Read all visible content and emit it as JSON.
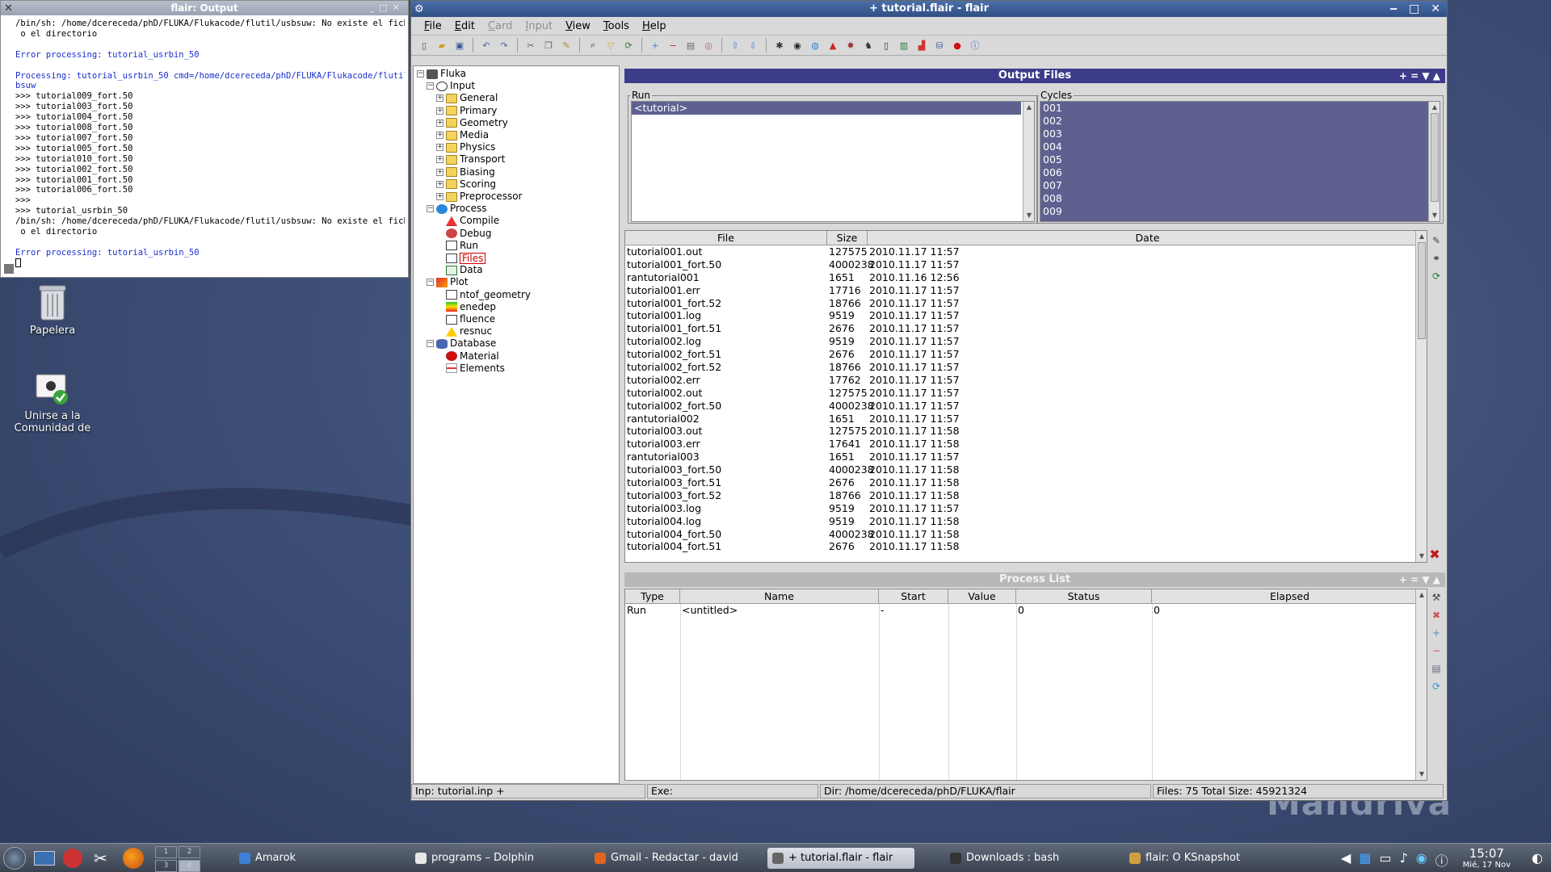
{
  "terminal": {
    "title": "flair: Output",
    "lines": [
      {
        "text": "/bin/sh: /home/dcereceda/phD/FLUKA/Flukacode/flutil/usbsuw: No existe el fichero",
        "color": "black"
      },
      {
        "text": " o el directorio",
        "color": "black"
      },
      {
        "text": "",
        "color": "black"
      },
      {
        "text": "Error processing: tutorial_usrbin_50",
        "color": "blue"
      },
      {
        "text": "",
        "color": "black"
      },
      {
        "text": "Processing: tutorial_usrbin_50 cmd=/home/dcereceda/phD/FLUKA/Flukacode/flutil/us",
        "color": "blue"
      },
      {
        "text": "bsuw",
        "color": "blue"
      },
      {
        "text": ">>> tutorial009_fort.50",
        "color": "black"
      },
      {
        "text": ">>> tutorial003_fort.50",
        "color": "black"
      },
      {
        "text": ">>> tutorial004_fort.50",
        "color": "black"
      },
      {
        "text": ">>> tutorial008_fort.50",
        "color": "black"
      },
      {
        "text": ">>> tutorial007_fort.50",
        "color": "black"
      },
      {
        "text": ">>> tutorial005_fort.50",
        "color": "black"
      },
      {
        "text": ">>> tutorial010_fort.50",
        "color": "black"
      },
      {
        "text": ">>> tutorial002_fort.50",
        "color": "black"
      },
      {
        "text": ">>> tutorial001_fort.50",
        "color": "black"
      },
      {
        "text": ">>> tutorial006_fort.50",
        "color": "black"
      },
      {
        "text": ">>>",
        "color": "black"
      },
      {
        "text": ">>> tutorial_usrbin_50",
        "color": "black"
      },
      {
        "text": "/bin/sh: /home/dcereceda/phD/FLUKA/Flukacode/flutil/usbsuw: No existe el fichero",
        "color": "black"
      },
      {
        "text": " o el directorio",
        "color": "black"
      },
      {
        "text": "",
        "color": "black"
      },
      {
        "text": "Error processing: tutorial_usrbin_50",
        "color": "blue"
      }
    ]
  },
  "desktop": {
    "trash_label": "Papelera",
    "community_label_1": "Unirse a la",
    "community_label_2": "Comunidad de"
  },
  "flair": {
    "title": "+ tutorial.flair - flair",
    "menu": [
      {
        "label": "File",
        "enabled": true
      },
      {
        "label": "Edit",
        "enabled": true
      },
      {
        "label": "Card",
        "enabled": false
      },
      {
        "label": "Input",
        "enabled": false
      },
      {
        "label": "View",
        "enabled": true
      },
      {
        "label": "Tools",
        "enabled": true
      },
      {
        "label": "Help",
        "enabled": true
      }
    ],
    "tree": [
      {
        "label": "Fluka",
        "level": 0,
        "icon": "fluka-icon"
      },
      {
        "label": "Input",
        "level": 1,
        "icon": "input-icon"
      },
      {
        "label": "General",
        "level": 2,
        "icon": "folder-icon"
      },
      {
        "label": "Primary",
        "level": 2,
        "icon": "folder-icon"
      },
      {
        "label": "Geometry",
        "level": 2,
        "icon": "folder-icon"
      },
      {
        "label": "Media",
        "level": 2,
        "icon": "folder-icon"
      },
      {
        "label": "Physics",
        "level": 2,
        "icon": "folder-icon"
      },
      {
        "label": "Transport",
        "level": 2,
        "icon": "folder-icon"
      },
      {
        "label": "Biasing",
        "level": 2,
        "icon": "folder-icon"
      },
      {
        "label": "Scoring",
        "level": 2,
        "icon": "folder-icon"
      },
      {
        "label": "Preprocessor",
        "level": 2,
        "icon": "folder-icon"
      },
      {
        "label": "Process",
        "level": 1,
        "icon": "process-icon"
      },
      {
        "label": "Compile",
        "level": 2,
        "icon": "compile-icon"
      },
      {
        "label": "Debug",
        "level": 2,
        "icon": "debug-icon"
      },
      {
        "label": "Run",
        "level": 2,
        "icon": "run-icon"
      },
      {
        "label": "Files",
        "level": 2,
        "icon": "files-icon"
      },
      {
        "label": "Data",
        "level": 2,
        "icon": "data-icon"
      },
      {
        "label": "Plot",
        "level": 1,
        "icon": "plot-icon"
      },
      {
        "label": "ntof_geometry",
        "level": 2,
        "icon": "file-icon"
      },
      {
        "label": "enedep",
        "level": 2,
        "icon": "usrbin-plot-icon"
      },
      {
        "label": "fluence",
        "level": 2,
        "icon": "file-icon"
      },
      {
        "label": "resnuc",
        "level": 2,
        "icon": "warning-icon"
      },
      {
        "label": "Database",
        "level": 1,
        "icon": "database-icon"
      },
      {
        "label": "Material",
        "level": 2,
        "icon": "material-icon"
      },
      {
        "label": "Elements",
        "level": 2,
        "icon": "elements-icon"
      }
    ],
    "output": {
      "title": "Output Files",
      "controls": "+ = ▼ ▲",
      "run_legend": "Run",
      "runs": [
        "<tutorial>"
      ],
      "cycles_legend": "Cycles",
      "cycles": [
        "001",
        "002",
        "003",
        "004",
        "005",
        "006",
        "007",
        "008",
        "009"
      ],
      "columns": [
        "File",
        "Size",
        "Date"
      ],
      "files": [
        [
          "tutorial001.out",
          "127575",
          "2010.11.17 11:57"
        ],
        [
          "tutorial001_fort.50",
          "4000238",
          "2010.11.17 11:57"
        ],
        [
          "rantutorial001",
          "1651",
          "2010.11.16 12:56"
        ],
        [
          "tutorial001.err",
          "17716",
          "2010.11.17 11:57"
        ],
        [
          "tutorial001_fort.52",
          "18766",
          "2010.11.17 11:57"
        ],
        [
          "tutorial001.log",
          "9519",
          "2010.11.17 11:57"
        ],
        [
          "tutorial001_fort.51",
          "2676",
          "2010.11.17 11:57"
        ],
        [
          "tutorial002.log",
          "9519",
          "2010.11.17 11:57"
        ],
        [
          "tutorial002_fort.51",
          "2676",
          "2010.11.17 11:57"
        ],
        [
          "tutorial002_fort.52",
          "18766",
          "2010.11.17 11:57"
        ],
        [
          "tutorial002.err",
          "17762",
          "2010.11.17 11:57"
        ],
        [
          "tutorial002.out",
          "127575",
          "2010.11.17 11:57"
        ],
        [
          "tutorial002_fort.50",
          "4000238",
          "2010.11.17 11:57"
        ],
        [
          "rantutorial002",
          "1651",
          "2010.11.17 11:57"
        ],
        [
          "tutorial003.out",
          "127575",
          "2010.11.17 11:58"
        ],
        [
          "tutorial003.err",
          "17641",
          "2010.11.17 11:58"
        ],
        [
          "rantutorial003",
          "1651",
          "2010.11.17 11:57"
        ],
        [
          "tutorial003_fort.50",
          "4000238",
          "2010.11.17 11:58"
        ],
        [
          "tutorial003_fort.51",
          "2676",
          "2010.11.17 11:58"
        ],
        [
          "tutorial003_fort.52",
          "18766",
          "2010.11.17 11:58"
        ],
        [
          "tutorial003.log",
          "9519",
          "2010.11.17 11:57"
        ],
        [
          "tutorial004.log",
          "9519",
          "2010.11.17 11:58"
        ],
        [
          "tutorial004_fort.50",
          "4000238",
          "2010.11.17 11:58"
        ],
        [
          "tutorial004_fort.51",
          "2676",
          "2010.11.17 11:58"
        ]
      ]
    },
    "process": {
      "title": "Process List",
      "controls": "+ = ▼ ▲",
      "columns": [
        "Type",
        "Name",
        "Start",
        "Value",
        "Status",
        "Elapsed"
      ],
      "rows": [
        [
          "Run",
          "<untitled>",
          "-",
          "",
          "0",
          "0"
        ]
      ]
    },
    "status": {
      "input": "Inp: tutorial.inp +",
      "exe": "Exe:",
      "dir": "Dir: /home/dcereceda/phD/FLUKA/flair",
      "files": "Files: 75 Total Size: 45921324"
    }
  },
  "taskbar": {
    "tasks": [
      {
        "label": "Amarok",
        "active": false,
        "color": "#3d7fd6"
      },
      {
        "label": "programs – Dolphin",
        "active": false,
        "color": "#e8e8e8"
      },
      {
        "label": "Gmail - Redactar - david",
        "active": false,
        "color": "#e2641d"
      },
      {
        "label": "+ tutorial.flair - flair",
        "active": true,
        "color": "#666666"
      },
      {
        "label": "Downloads : bash",
        "active": false,
        "color": "#333333"
      },
      {
        "label": "flair: O KSnapshot",
        "active": false,
        "color": "#d0a040"
      }
    ],
    "pager": [
      "1",
      "2",
      "3",
      "4"
    ],
    "time": "15:07",
    "date": "Mié, 17 Nov"
  },
  "colors": {
    "output_header": "#3c3c8a",
    "list_highlight": "#5e6190",
    "term_blue": "#1a2fd0"
  }
}
